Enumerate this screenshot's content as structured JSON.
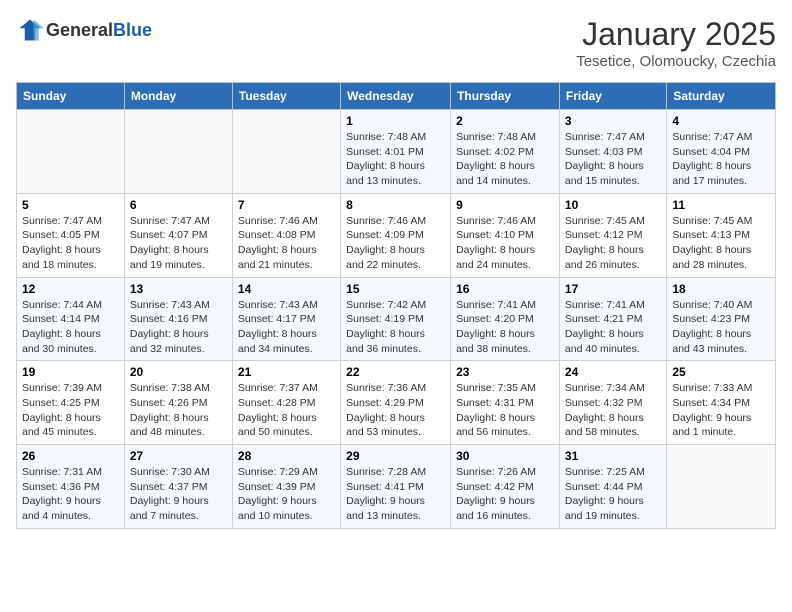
{
  "header": {
    "logo": {
      "general": "General",
      "blue": "Blue"
    },
    "title": "January 2025",
    "subtitle": "Tesetice, Olomoucky, Czechia"
  },
  "weekdays": [
    "Sunday",
    "Monday",
    "Tuesday",
    "Wednesday",
    "Thursday",
    "Friday",
    "Saturday"
  ],
  "weeks": [
    [
      {
        "day": "",
        "sunrise": "",
        "sunset": "",
        "daylight": ""
      },
      {
        "day": "",
        "sunrise": "",
        "sunset": "",
        "daylight": ""
      },
      {
        "day": "",
        "sunrise": "",
        "sunset": "",
        "daylight": ""
      },
      {
        "day": "1",
        "sunrise": "Sunrise: 7:48 AM",
        "sunset": "Sunset: 4:01 PM",
        "daylight": "Daylight: 8 hours and 13 minutes."
      },
      {
        "day": "2",
        "sunrise": "Sunrise: 7:48 AM",
        "sunset": "Sunset: 4:02 PM",
        "daylight": "Daylight: 8 hours and 14 minutes."
      },
      {
        "day": "3",
        "sunrise": "Sunrise: 7:47 AM",
        "sunset": "Sunset: 4:03 PM",
        "daylight": "Daylight: 8 hours and 15 minutes."
      },
      {
        "day": "4",
        "sunrise": "Sunrise: 7:47 AM",
        "sunset": "Sunset: 4:04 PM",
        "daylight": "Daylight: 8 hours and 17 minutes."
      }
    ],
    [
      {
        "day": "5",
        "sunrise": "Sunrise: 7:47 AM",
        "sunset": "Sunset: 4:05 PM",
        "daylight": "Daylight: 8 hours and 18 minutes."
      },
      {
        "day": "6",
        "sunrise": "Sunrise: 7:47 AM",
        "sunset": "Sunset: 4:07 PM",
        "daylight": "Daylight: 8 hours and 19 minutes."
      },
      {
        "day": "7",
        "sunrise": "Sunrise: 7:46 AM",
        "sunset": "Sunset: 4:08 PM",
        "daylight": "Daylight: 8 hours and 21 minutes."
      },
      {
        "day": "8",
        "sunrise": "Sunrise: 7:46 AM",
        "sunset": "Sunset: 4:09 PM",
        "daylight": "Daylight: 8 hours and 22 minutes."
      },
      {
        "day": "9",
        "sunrise": "Sunrise: 7:46 AM",
        "sunset": "Sunset: 4:10 PM",
        "daylight": "Daylight: 8 hours and 24 minutes."
      },
      {
        "day": "10",
        "sunrise": "Sunrise: 7:45 AM",
        "sunset": "Sunset: 4:12 PM",
        "daylight": "Daylight: 8 hours and 26 minutes."
      },
      {
        "day": "11",
        "sunrise": "Sunrise: 7:45 AM",
        "sunset": "Sunset: 4:13 PM",
        "daylight": "Daylight: 8 hours and 28 minutes."
      }
    ],
    [
      {
        "day": "12",
        "sunrise": "Sunrise: 7:44 AM",
        "sunset": "Sunset: 4:14 PM",
        "daylight": "Daylight: 8 hours and 30 minutes."
      },
      {
        "day": "13",
        "sunrise": "Sunrise: 7:43 AM",
        "sunset": "Sunset: 4:16 PM",
        "daylight": "Daylight: 8 hours and 32 minutes."
      },
      {
        "day": "14",
        "sunrise": "Sunrise: 7:43 AM",
        "sunset": "Sunset: 4:17 PM",
        "daylight": "Daylight: 8 hours and 34 minutes."
      },
      {
        "day": "15",
        "sunrise": "Sunrise: 7:42 AM",
        "sunset": "Sunset: 4:19 PM",
        "daylight": "Daylight: 8 hours and 36 minutes."
      },
      {
        "day": "16",
        "sunrise": "Sunrise: 7:41 AM",
        "sunset": "Sunset: 4:20 PM",
        "daylight": "Daylight: 8 hours and 38 minutes."
      },
      {
        "day": "17",
        "sunrise": "Sunrise: 7:41 AM",
        "sunset": "Sunset: 4:21 PM",
        "daylight": "Daylight: 8 hours and 40 minutes."
      },
      {
        "day": "18",
        "sunrise": "Sunrise: 7:40 AM",
        "sunset": "Sunset: 4:23 PM",
        "daylight": "Daylight: 8 hours and 43 minutes."
      }
    ],
    [
      {
        "day": "19",
        "sunrise": "Sunrise: 7:39 AM",
        "sunset": "Sunset: 4:25 PM",
        "daylight": "Daylight: 8 hours and 45 minutes."
      },
      {
        "day": "20",
        "sunrise": "Sunrise: 7:38 AM",
        "sunset": "Sunset: 4:26 PM",
        "daylight": "Daylight: 8 hours and 48 minutes."
      },
      {
        "day": "21",
        "sunrise": "Sunrise: 7:37 AM",
        "sunset": "Sunset: 4:28 PM",
        "daylight": "Daylight: 8 hours and 50 minutes."
      },
      {
        "day": "22",
        "sunrise": "Sunrise: 7:36 AM",
        "sunset": "Sunset: 4:29 PM",
        "daylight": "Daylight: 8 hours and 53 minutes."
      },
      {
        "day": "23",
        "sunrise": "Sunrise: 7:35 AM",
        "sunset": "Sunset: 4:31 PM",
        "daylight": "Daylight: 8 hours and 56 minutes."
      },
      {
        "day": "24",
        "sunrise": "Sunrise: 7:34 AM",
        "sunset": "Sunset: 4:32 PM",
        "daylight": "Daylight: 8 hours and 58 minutes."
      },
      {
        "day": "25",
        "sunrise": "Sunrise: 7:33 AM",
        "sunset": "Sunset: 4:34 PM",
        "daylight": "Daylight: 9 hours and 1 minute."
      }
    ],
    [
      {
        "day": "26",
        "sunrise": "Sunrise: 7:31 AM",
        "sunset": "Sunset: 4:36 PM",
        "daylight": "Daylight: 9 hours and 4 minutes."
      },
      {
        "day": "27",
        "sunrise": "Sunrise: 7:30 AM",
        "sunset": "Sunset: 4:37 PM",
        "daylight": "Daylight: 9 hours and 7 minutes."
      },
      {
        "day": "28",
        "sunrise": "Sunrise: 7:29 AM",
        "sunset": "Sunset: 4:39 PM",
        "daylight": "Daylight: 9 hours and 10 minutes."
      },
      {
        "day": "29",
        "sunrise": "Sunrise: 7:28 AM",
        "sunset": "Sunset: 4:41 PM",
        "daylight": "Daylight: 9 hours and 13 minutes."
      },
      {
        "day": "30",
        "sunrise": "Sunrise: 7:26 AM",
        "sunset": "Sunset: 4:42 PM",
        "daylight": "Daylight: 9 hours and 16 minutes."
      },
      {
        "day": "31",
        "sunrise": "Sunrise: 7:25 AM",
        "sunset": "Sunset: 4:44 PM",
        "daylight": "Daylight: 9 hours and 19 minutes."
      },
      {
        "day": "",
        "sunrise": "",
        "sunset": "",
        "daylight": ""
      }
    ]
  ]
}
